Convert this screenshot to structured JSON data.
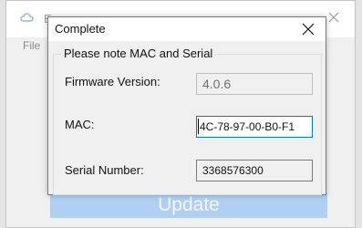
{
  "background_window": {
    "title_fragment": "E",
    "menu": {
      "file_label": "File"
    },
    "update_button_label": "Update"
  },
  "dialog": {
    "title": "Complete",
    "group_label": "Please note MAC and Serial",
    "fields": {
      "firmware": {
        "label": "Firmware Version:",
        "value": "4.0.6"
      },
      "mac": {
        "label": "MAC:",
        "value": "4C-78-97-00-B0-F1"
      },
      "serial": {
        "label": "Serial Number:",
        "value": "3368576300"
      }
    }
  },
  "icons": {
    "app": "cloud-icon",
    "close": "close-icon"
  },
  "colors": {
    "accent": "#0078d7",
    "update_button_bg": "#afd0f2"
  }
}
